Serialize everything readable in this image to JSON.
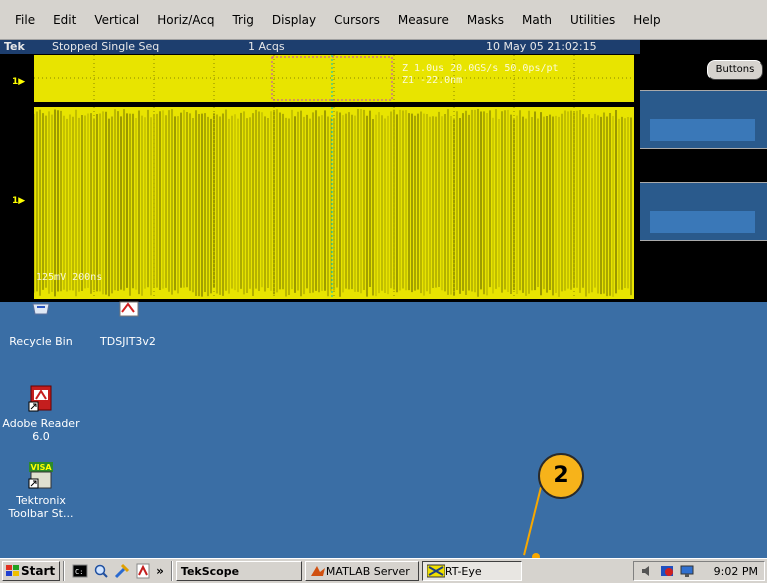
{
  "menu": [
    "File",
    "Edit",
    "Vertical",
    "Horiz/Acq",
    "Trig",
    "Display",
    "Cursors",
    "Measure",
    "Masks",
    "Math",
    "Utilities",
    "Help"
  ],
  "status": {
    "brand": "Tek",
    "state": "Stopped  Single Seq",
    "acqs": "1 Acqs",
    "datetime": "10 May 05 21:02:15"
  },
  "scope": {
    "zoom_readout_line1": "Z 1.0us  20.0GS/s     50.0ps/pt",
    "zoom_readout_line2": "Z1          -22.0nm",
    "scale_readout": "125mV     200ns",
    "channel_markers": [
      "1",
      "1"
    ],
    "buttons_label": "Buttons",
    "trace_color": "#e8e400",
    "screen_color": "#000000"
  },
  "desktop": {
    "icons": [
      {
        "label": "Recycle Bin",
        "icon": "recycle-bin-icon"
      },
      {
        "label": "TDSJIT3v2",
        "icon": "adobe-document-icon"
      },
      {
        "label": "Adobe Reader 6.0",
        "icon": "adobe-reader-icon"
      },
      {
        "label": "Tektronix Toolbar St...",
        "icon": "visa-toolbar-icon"
      }
    ],
    "background": "#3a6ea5"
  },
  "callout": {
    "number": "2",
    "color": "#f7b31a"
  },
  "taskbar": {
    "start_label": "Start",
    "chevron": "»",
    "buttons": [
      {
        "label": "TekScope",
        "active": false
      },
      {
        "label": "MATLAB Server",
        "active": false
      },
      {
        "label": "RT-Eye",
        "active": true
      }
    ],
    "clock": "9:02 PM"
  }
}
